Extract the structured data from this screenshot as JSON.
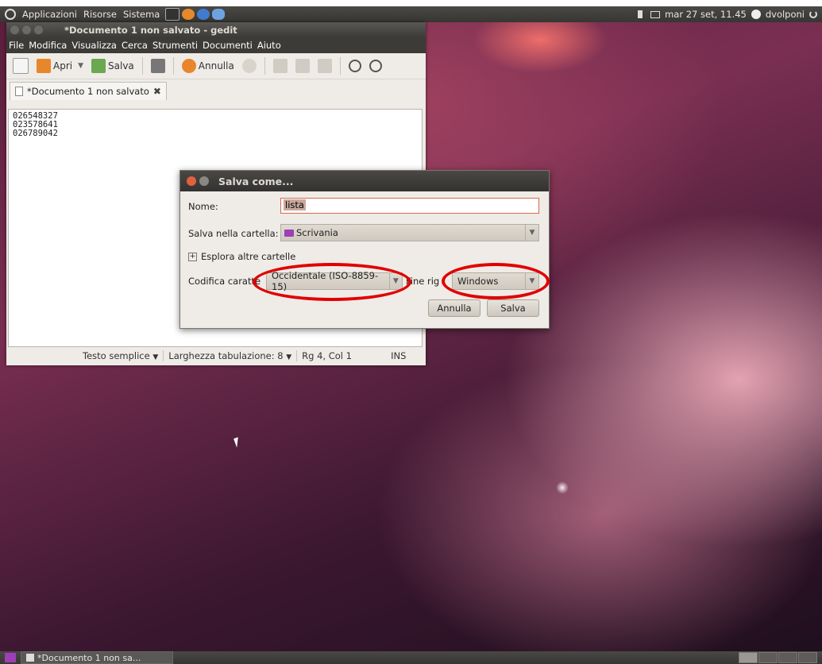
{
  "top_panel": {
    "menus": [
      "Applicazioni",
      "Risorse",
      "Sistema"
    ],
    "datetime": "mar 27 set, 11.45",
    "user": "dvolponi"
  },
  "gedit": {
    "title": "*Documento 1 non salvato - gedit",
    "menu": [
      "File",
      "Modifica",
      "Visualizza",
      "Cerca",
      "Strumenti",
      "Documenti",
      "Aiuto"
    ],
    "toolbar": {
      "open_label": "Apri",
      "save_label": "Salva",
      "undo_label": "Annulla"
    },
    "tab_label": "*Documento 1 non salvato",
    "document_lines": [
      "026548327",
      "023578641",
      "026789042"
    ],
    "statusbar": {
      "language": "Testo semplice",
      "tab_width": "Larghezza tabulazione: 8",
      "position": "Rg 4, Col 1",
      "mode": "INS"
    }
  },
  "save_dialog": {
    "title": "Salva come...",
    "name_label": "Nome:",
    "name_value": "lista",
    "folder_label": "Salva nella cartella:",
    "folder_value": "Scrivania",
    "browse_label": "Esplora altre cartelle",
    "encoding_label": "Codifica caratte",
    "encoding_value": "Occidentale (ISO-8859-15)",
    "line_ending_label": "Fine rig",
    "line_ending_value": "Windows",
    "cancel_label": "Annulla",
    "save_label": "Salva"
  },
  "bottom_panel": {
    "task_label": "*Documento 1 non sa..."
  },
  "colors": {
    "panel": "#3c3b37",
    "dialog_bg": "#efebe7",
    "annotation_red": "#e00000",
    "wallpaper_purple": "#7a2f52"
  }
}
